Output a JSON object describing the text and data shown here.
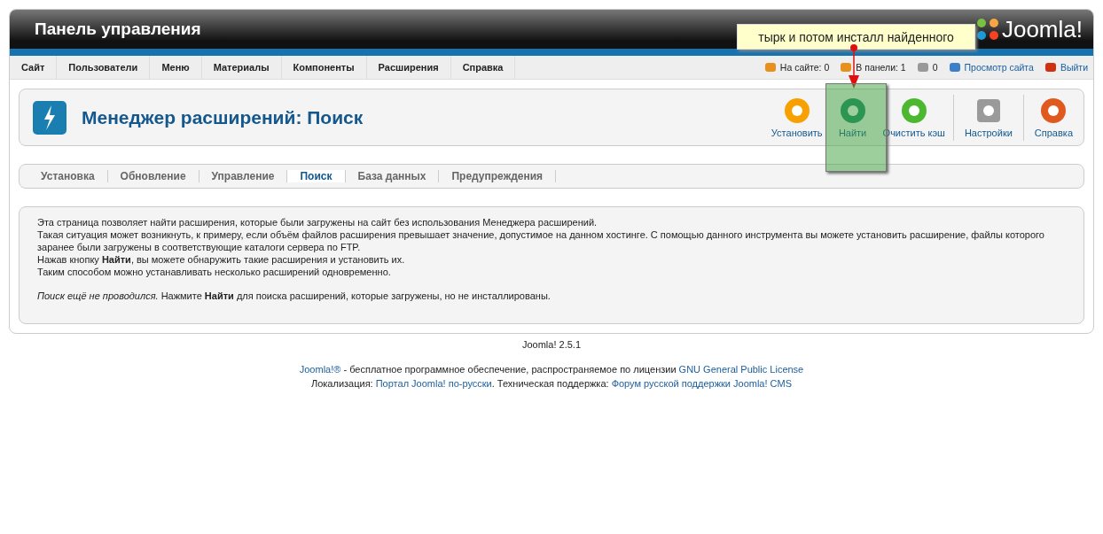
{
  "header": {
    "title": "Панель управления",
    "logo": "Joomla!"
  },
  "menu": [
    "Сайт",
    "Пользователи",
    "Меню",
    "Материалы",
    "Компоненты",
    "Расширения",
    "Справка"
  ],
  "status": [
    {
      "kind": "users",
      "text": "На сайте: 0"
    },
    {
      "kind": "admins",
      "text": "В панели: 1"
    },
    {
      "kind": "messages",
      "text": "0"
    },
    {
      "kind": "view",
      "text": "Просмотр сайта"
    },
    {
      "kind": "logout",
      "text": "Выйти"
    }
  ],
  "page_title": "Менеджер расширений: Поиск",
  "toolbar": [
    {
      "kind": "install",
      "label": "Установить"
    },
    {
      "kind": "find",
      "label": "Найти"
    },
    {
      "kind": "clear",
      "label": "Очистить кэш"
    },
    {
      "kind": "options",
      "label": "Настройки"
    },
    {
      "kind": "help",
      "label": "Справка"
    }
  ],
  "tabs": [
    {
      "label": "Установка",
      "selected": false
    },
    {
      "label": "Обновление",
      "selected": false
    },
    {
      "label": "Управление",
      "selected": false
    },
    {
      "label": "Поиск",
      "selected": true
    },
    {
      "label": "База данных",
      "selected": false
    },
    {
      "label": "Предупреждения",
      "selected": false
    }
  ],
  "description": [
    "Эта страница позволяет найти расширения, которые были загружены на сайт без использования Менеджера расширений.",
    "Такая ситуация может возникнуть, к примеру, если объём файлов расширения превышает значение, допустимое на данном хостинге. С помощью данного инструмента вы можете установить расширение, файлы которого заранее были загружены в соответствующие каталоги сервера по FTP.",
    "Нажав кнопку **Найти**, вы можете обнаружить такие расширения и установить их.",
    "Таким способом можно устанавливать несколько расширений одновременно."
  ],
  "notice": "*Поиск ещё не проводился.* Нажмите **Найти** для поиска расширений, которые загружены, но не инсталлированы.",
  "version": "Joomla! 2.5.1",
  "footer": [
    [
      {
        "kind": "link",
        "text": "Joomla!®"
      },
      {
        "kind": "text",
        "text": " - бесплатное программное обеспечение, распространяемое по лицензии "
      },
      {
        "kind": "link",
        "text": "GNU General Public License"
      }
    ],
    [
      {
        "kind": "text",
        "text": "Локализация: "
      },
      {
        "kind": "link",
        "text": "Портал Joomla! по-русски"
      },
      {
        "kind": "text",
        "text": ". Техническая поддержка: "
      },
      {
        "kind": "link",
        "text": "Форум русской поддержки Joomla! CMS"
      }
    ]
  ],
  "annotation": {
    "note": "тырк и потом инсталл найденного"
  }
}
